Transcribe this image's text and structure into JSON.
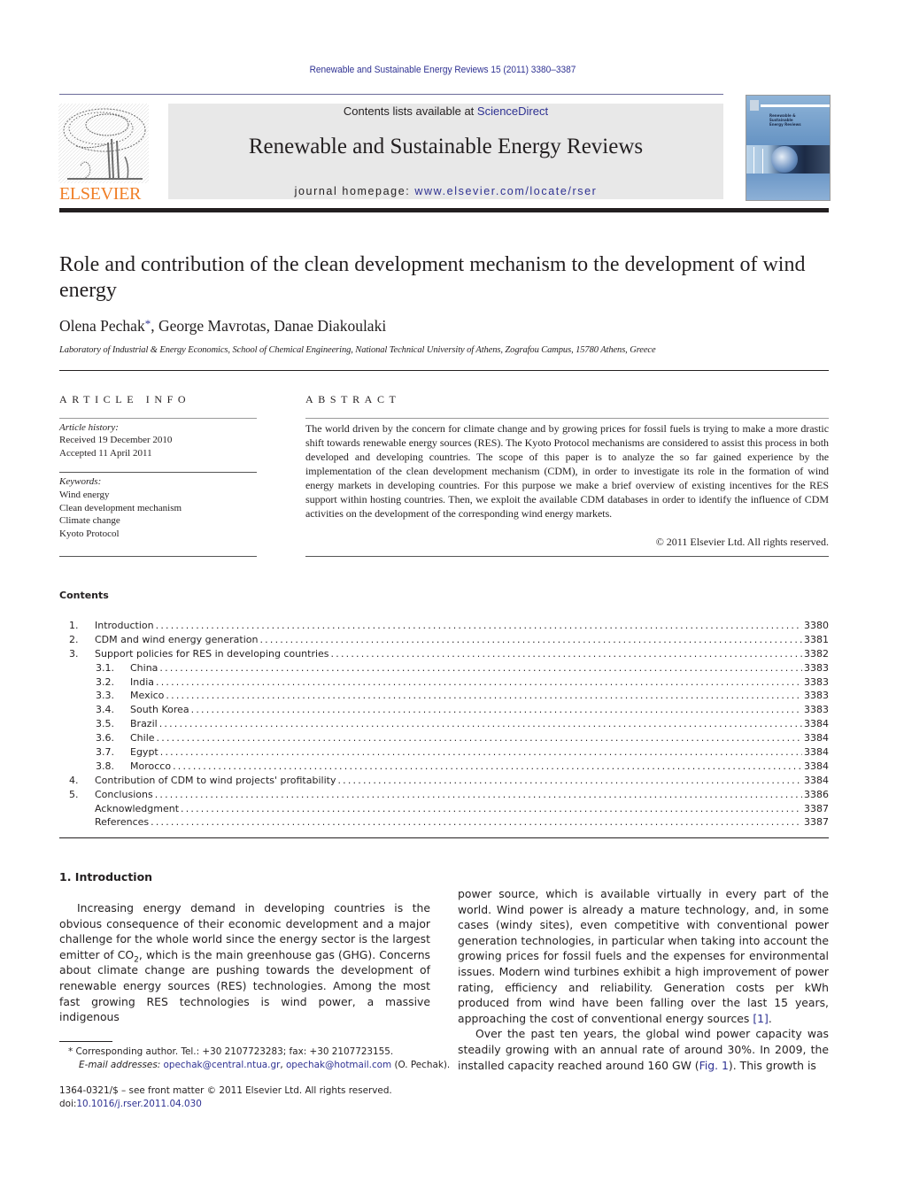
{
  "header": {
    "journal_reference": "Renewable and Sustainable Energy Reviews 15 (2011) 3380–3387",
    "contents_prefix": "Contents lists available at ",
    "contents_link": "ScienceDirect",
    "journal_title": "Renewable and Sustainable Energy Reviews",
    "homepage_prefix": "journal homepage: ",
    "homepage_link": "www.elsevier.com/locate/rser",
    "publisher_logo_text": "ELSEVIER",
    "cover_title_lines": [
      "Renewable &",
      "Sustainable",
      "Energy Reviews"
    ]
  },
  "colors": {
    "link": "#2e3192",
    "publisher_orange": "#f07e26",
    "masthead_bg": "#e8e8e8"
  },
  "article": {
    "title": "Role and contribution of the clean development mechanism to the development of wind energy",
    "authors": [
      {
        "name": "Olena Pechak",
        "corresponding": true
      },
      {
        "name": "George Mavrotas",
        "corresponding": false
      },
      {
        "name": "Danae Diakoulaki",
        "corresponding": false
      }
    ],
    "author_sep": ", ",
    "corresponding_mark": "*",
    "affiliation": "Laboratory of Industrial & Energy Economics, School of Chemical Engineering, National Technical University of Athens, Zografou Campus, 15780 Athens, Greece"
  },
  "article_info": {
    "heading": "ARTICLE INFO",
    "history_label": "Article history:",
    "received": "Received 19 December 2010",
    "accepted": "Accepted 11 April 2011",
    "keywords_label": "Keywords:",
    "keywords": [
      "Wind energy",
      "Clean development mechanism",
      "Climate change",
      "Kyoto Protocol"
    ]
  },
  "abstract": {
    "heading": "ABSTRACT",
    "text": "The world driven by the concern for climate change and by growing prices for fossil fuels is trying to make a more drastic shift towards renewable energy sources (RES). The Kyoto Protocol mechanisms are considered to assist this process in both developed and developing countries. The scope of this paper is to analyze the so far gained experience by the implementation of the clean development mechanism (CDM), in order to investigate its role in the formation of wind energy markets in developing countries. For this purpose we make a brief overview of existing incentives for the RES support within hosting countries. Then, we exploit the available CDM databases in order to identify the influence of CDM activities on the development of the corresponding wind energy markets.",
    "copyright": "© 2011 Elsevier Ltd. All rights reserved."
  },
  "contents": {
    "heading": "Contents",
    "entries": [
      {
        "num": "1.",
        "label": "Introduction",
        "page": "3380",
        "level": 1
      },
      {
        "num": "2.",
        "label": "CDM and wind energy generation",
        "page": "3381",
        "level": 1
      },
      {
        "num": "3.",
        "label": "Support policies for RES in developing countries",
        "page": "3382",
        "level": 1
      },
      {
        "num": "3.1.",
        "label": "China",
        "page": "3383",
        "level": 2
      },
      {
        "num": "3.2.",
        "label": "India",
        "page": "3383",
        "level": 2
      },
      {
        "num": "3.3.",
        "label": "Mexico",
        "page": "3383",
        "level": 2
      },
      {
        "num": "3.4.",
        "label": "South Korea",
        "page": "3383",
        "level": 2
      },
      {
        "num": "3.5.",
        "label": "Brazil",
        "page": "3384",
        "level": 2
      },
      {
        "num": "3.6.",
        "label": "Chile",
        "page": "3384",
        "level": 2
      },
      {
        "num": "3.7.",
        "label": "Egypt",
        "page": "3384",
        "level": 2
      },
      {
        "num": "3.8.",
        "label": "Morocco",
        "page": "3384",
        "level": 2
      },
      {
        "num": "4.",
        "label": "Contribution of CDM to wind projects' profitability",
        "page": "3384",
        "level": 1
      },
      {
        "num": "5.",
        "label": "Conclusions",
        "page": "3386",
        "level": 1
      },
      {
        "num": "",
        "label": "Acknowledgment",
        "page": "3387",
        "level": 1
      },
      {
        "num": "",
        "label": "References",
        "page": "3387",
        "level": 1
      }
    ]
  },
  "body": {
    "section_heading": "1.  Introduction",
    "left_p1_a": "Increasing energy demand in developing countries is the obvious consequence of their economic development and a major challenge for the whole world since the energy sector is the largest emitter of CO",
    "left_p1_sub": "2",
    "left_p1_b": ", which is the main greenhouse gas (GHG). Concerns about climate change are pushing towards the development of renewable energy sources (RES) technologies. Among the most fast growing RES technologies is wind power, a massive indigenous",
    "right_p1_a": "power source, which is available virtually in every part of the world. Wind power is already a mature technology, and, in some cases (windy sites), even competitive with conventional power generation technologies, in particular when taking into account the growing prices for fossil fuels and the expenses for environmental issues. Modern wind turbines exhibit a high improvement of power rating, efficiency and reliability. Generation costs per kWh produced from wind have been falling over the last 15 years, approaching the cost of conventional energy sources ",
    "right_p1_ref": "[1]",
    "right_p1_end": ".",
    "right_p2_a": "Over the past ten years, the global wind power capacity was steadily growing with an annual rate of around 30%. In 2009, the installed capacity reached around 160 GW (",
    "right_p2_ref": "Fig. 1",
    "right_p2_b": "). This growth is"
  },
  "footnotes": {
    "corresponding": "* Corresponding author. Tel.: +30 2107723283; fax: +30 2107723155.",
    "email_label": "E-mail addresses: ",
    "email_1": "opechak@central.ntua.gr",
    "email_sep": ", ",
    "email_2": "opechak@hotmail.com",
    "email_suffix": " (O. Pechak).",
    "front_matter": "1364-0321/$ – see front matter © 2011 Elsevier Ltd. All rights reserved.",
    "doi_prefix": "doi:",
    "doi": "10.1016/j.rser.2011.04.030"
  }
}
